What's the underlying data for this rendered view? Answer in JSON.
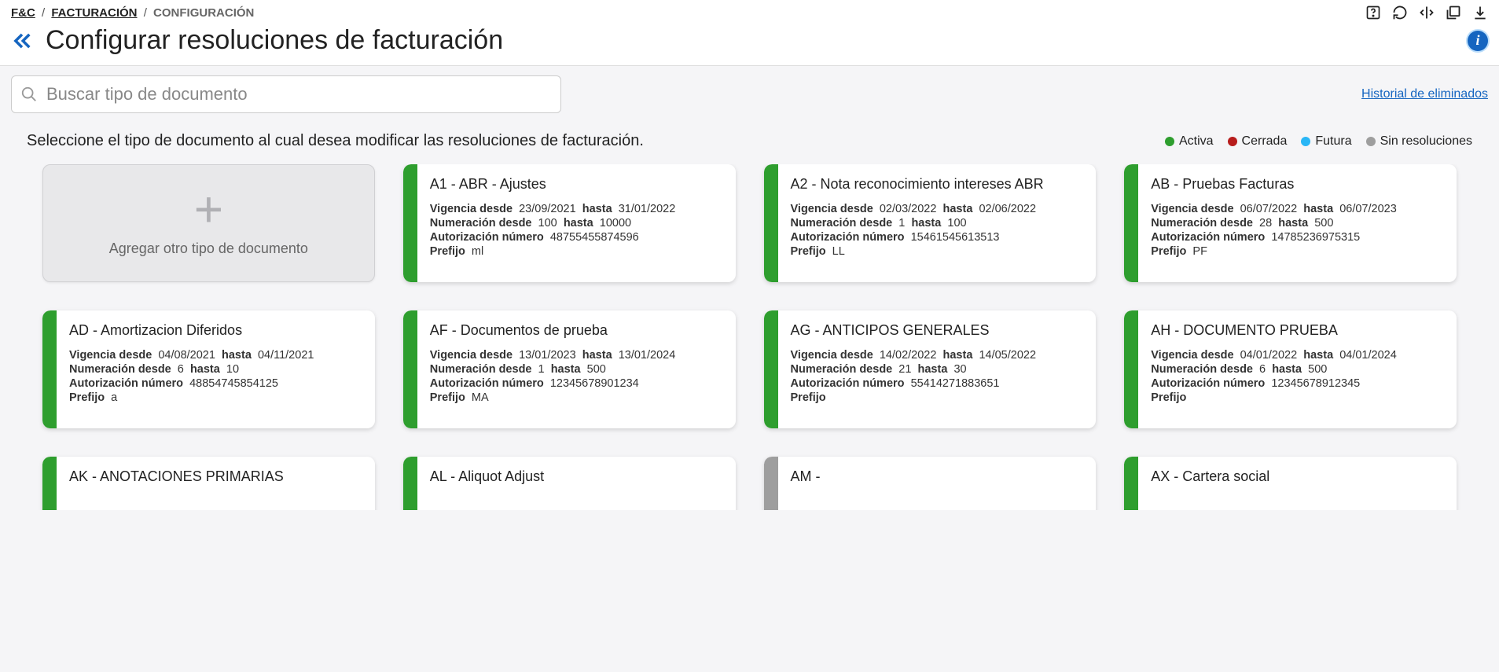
{
  "breadcrumb": {
    "root": "F&C",
    "mid": "FACTURACIÓN",
    "current": "CONFIGURACIÓN"
  },
  "page_title": "Configurar resoluciones de facturación",
  "search": {
    "placeholder": "Buscar tipo de documento"
  },
  "history_link": "Historial de eliminados",
  "instructions": "Seleccione el tipo de documento al cual desea modificar las resoluciones de facturación.",
  "legend": {
    "activa": "Activa",
    "cerrada": "Cerrada",
    "futura": "Futura",
    "sin": "Sin resoluciones"
  },
  "add_card_label": "Agregar otro tipo de documento",
  "labels": {
    "vig_desde": "Vigencia desde",
    "hasta": "hasta",
    "num_desde": "Numeración desde",
    "auth": "Autorización número",
    "prefijo": "Prefijo"
  },
  "cards": [
    {
      "title": "A1 - ABR - Ajustes",
      "status": "green",
      "vig_desde": "23/09/2021",
      "vig_hasta": "31/01/2022",
      "num_desde": "100",
      "num_hasta": "10000",
      "auth": "48755455874596",
      "prefijo": "ml"
    },
    {
      "title": "A2 - Nota reconocimiento intereses ABR",
      "status": "green",
      "vig_desde": "02/03/2022",
      "vig_hasta": "02/06/2022",
      "num_desde": "1",
      "num_hasta": "100",
      "auth": "15461545613513",
      "prefijo": "LL"
    },
    {
      "title": "AB - Pruebas Facturas",
      "status": "green",
      "vig_desde": "06/07/2022",
      "vig_hasta": "06/07/2023",
      "num_desde": "28",
      "num_hasta": "500",
      "auth": "14785236975315",
      "prefijo": "PF"
    },
    {
      "title": "AD - Amortizacion Diferidos",
      "status": "green",
      "vig_desde": "04/08/2021",
      "vig_hasta": "04/11/2021",
      "num_desde": "6",
      "num_hasta": "10",
      "auth": "48854745854125",
      "prefijo": "a"
    },
    {
      "title": "AF - Documentos de prueba",
      "status": "green",
      "vig_desde": "13/01/2023",
      "vig_hasta": "13/01/2024",
      "num_desde": "1",
      "num_hasta": "500",
      "auth": "12345678901234",
      "prefijo": "MA"
    },
    {
      "title": "AG - ANTICIPOS GENERALES",
      "status": "green",
      "vig_desde": "14/02/2022",
      "vig_hasta": "14/05/2022",
      "num_desde": "21",
      "num_hasta": "30",
      "auth": "55414271883651",
      "prefijo": ""
    },
    {
      "title": "AH - DOCUMENTO PRUEBA",
      "status": "green",
      "vig_desde": "04/01/2022",
      "vig_hasta": "04/01/2024",
      "num_desde": "6",
      "num_hasta": "500",
      "auth": "12345678912345",
      "prefijo": ""
    }
  ],
  "peek_cards": [
    {
      "title": "AK - ANOTACIONES PRIMARIAS",
      "status": "green"
    },
    {
      "title": "AL - Aliquot Adjust",
      "status": "green"
    },
    {
      "title": "AM - ",
      "status": "gray"
    },
    {
      "title": "AX - Cartera social",
      "status": "green"
    }
  ]
}
